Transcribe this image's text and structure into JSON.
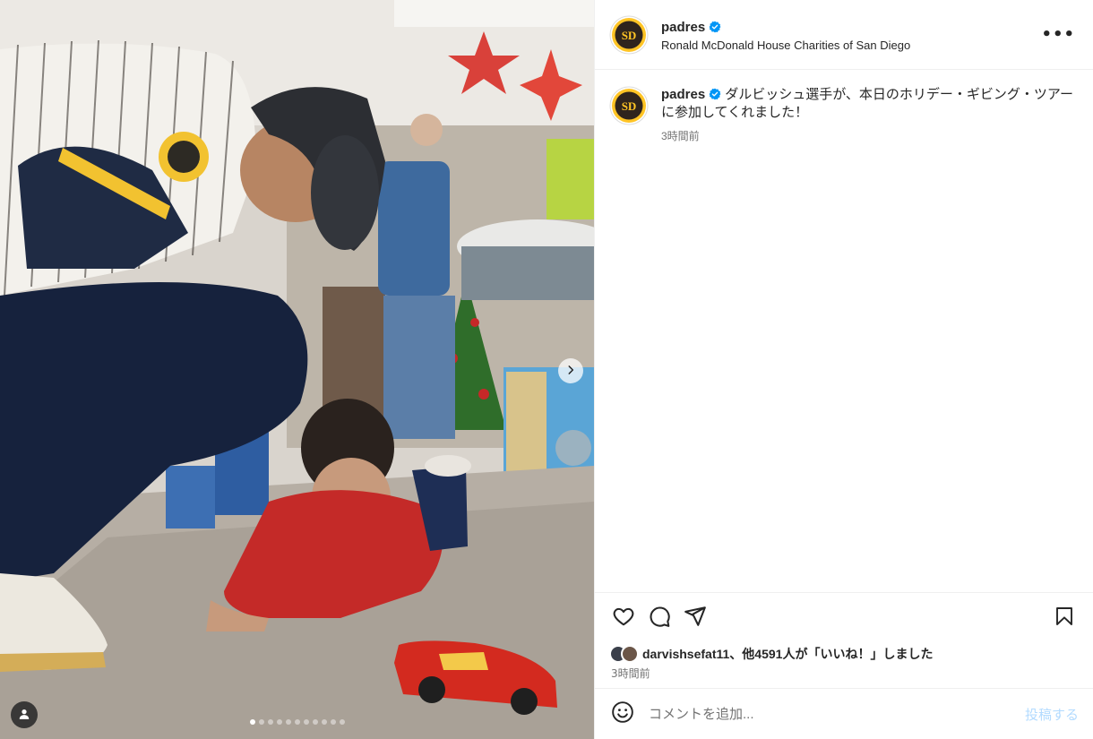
{
  "account": {
    "username": "padres",
    "location": "Ronald McDonald House Charities of San Diego",
    "avatar_colors": {
      "ring": "#FFC425",
      "fill": "#2F241D"
    }
  },
  "icons": {
    "verified": "verified-badge-icon",
    "more": "more-options-icon",
    "like": "heart-icon",
    "comment": "comment-icon",
    "share": "share-icon",
    "save": "bookmark-icon",
    "emoji": "emoji-icon",
    "user_tag": "user-tag-icon",
    "next": "chevron-right-icon"
  },
  "header": {
    "more_label": "•••"
  },
  "caption": {
    "username": "padres",
    "text": "ダルビッシュ選手が、本日のホリデー・ギビング・ツアーに参加してくれました！",
    "time": "3時間前"
  },
  "likes": {
    "first_user": "darvishsefat11",
    "rest": "、他4591人が「いいね！」しました"
  },
  "post_time": "3時間前",
  "add_comment": {
    "placeholder": "コメントを追加...",
    "post_label": "投稿する"
  },
  "carousel": {
    "total": 11,
    "current": 1
  },
  "colors": {
    "accent": "#0095F6",
    "verified": "#0095F6",
    "post_disabled": "#B3DBFF",
    "muted": "#737373"
  }
}
